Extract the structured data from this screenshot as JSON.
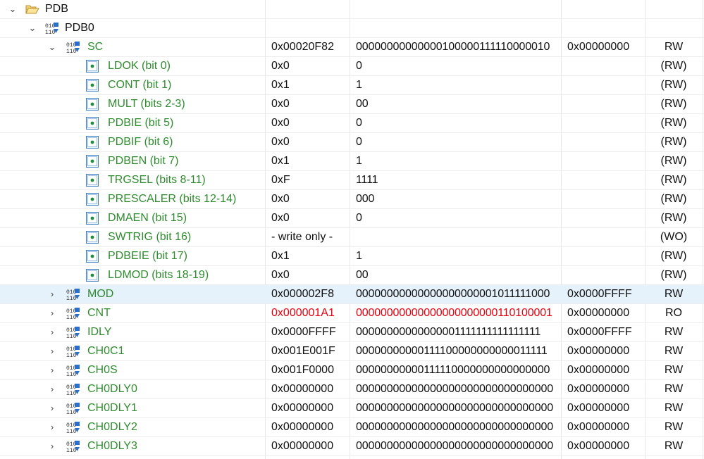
{
  "colors": {
    "field_green": "#2e8b2e",
    "changed_red": "#e8000d",
    "selected_row": "#e5f1fb"
  },
  "tree": {
    "peripheral": {
      "label": "PDB",
      "icon": "folder-open-icon"
    },
    "instance": {
      "label": "PDB0",
      "icon": "peripheral-icon"
    }
  },
  "rows": [
    {
      "kind": "register",
      "expanded": true,
      "name": "SC",
      "hex": "0x00020F82",
      "bin": "00000000000000100000111110000010",
      "reset": "0x00000000",
      "access": "RW"
    },
    {
      "kind": "field",
      "name": "LDOK (bit 0)",
      "hex": "0x0",
      "bin": "0",
      "reset": "",
      "access": "(RW)"
    },
    {
      "kind": "field",
      "name": "CONT (bit 1)",
      "hex": "0x1",
      "bin": "1",
      "reset": "",
      "access": "(RW)"
    },
    {
      "kind": "field",
      "name": "MULT (bits 2-3)",
      "hex": "0x0",
      "bin": "00",
      "reset": "",
      "access": "(RW)"
    },
    {
      "kind": "field",
      "name": "PDBIE (bit 5)",
      "hex": "0x0",
      "bin": "0",
      "reset": "",
      "access": "(RW)"
    },
    {
      "kind": "field",
      "name": "PDBIF (bit 6)",
      "hex": "0x0",
      "bin": "0",
      "reset": "",
      "access": "(RW)"
    },
    {
      "kind": "field",
      "name": "PDBEN (bit 7)",
      "hex": "0x1",
      "bin": "1",
      "reset": "",
      "access": "(RW)"
    },
    {
      "kind": "field",
      "name": "TRGSEL (bits 8-11)",
      "hex": "0xF",
      "bin": "1111",
      "reset": "",
      "access": "(RW)"
    },
    {
      "kind": "field",
      "name": "PRESCALER (bits 12-14)",
      "hex": "0x0",
      "bin": "000",
      "reset": "",
      "access": "(RW)"
    },
    {
      "kind": "field",
      "name": "DMAEN (bit 15)",
      "hex": "0x0",
      "bin": "0",
      "reset": "",
      "access": "(RW)"
    },
    {
      "kind": "field",
      "name": "SWTRIG (bit 16)",
      "hex": "- write only -",
      "bin": "",
      "reset": "",
      "access": "(WO)"
    },
    {
      "kind": "field",
      "name": "PDBEIE (bit 17)",
      "hex": "0x1",
      "bin": "1",
      "reset": "",
      "access": "(RW)"
    },
    {
      "kind": "field",
      "name": "LDMOD (bits 18-19)",
      "hex": "0x0",
      "bin": "00",
      "reset": "",
      "access": "(RW)"
    },
    {
      "kind": "register",
      "expanded": false,
      "selected": true,
      "name": "MOD",
      "hex": "0x000002F8",
      "bin": "00000000000000000000001011111000",
      "reset": "0x0000FFFF",
      "access": "RW"
    },
    {
      "kind": "register",
      "expanded": false,
      "changed": true,
      "name": "CNT",
      "hex": "0x000001A1",
      "bin": "00000000000000000000000110100001",
      "reset": "0x00000000",
      "access": "RO"
    },
    {
      "kind": "register",
      "expanded": false,
      "name": "IDLY",
      "hex": "0x0000FFFF",
      "bin": "00000000000000001111111111111111",
      "reset": "0x0000FFFF",
      "access": "RW"
    },
    {
      "kind": "register",
      "expanded": false,
      "name": "CH0C1",
      "hex": "0x001E001F",
      "bin": "00000000000111100000000000011111",
      "reset": "0x00000000",
      "access": "RW"
    },
    {
      "kind": "register",
      "expanded": false,
      "name": "CH0S",
      "hex": "0x001F0000",
      "bin": "00000000000111110000000000000000",
      "reset": "0x00000000",
      "access": "RW"
    },
    {
      "kind": "register",
      "expanded": false,
      "name": "CH0DLY0",
      "hex": "0x00000000",
      "bin": "00000000000000000000000000000000",
      "reset": "0x00000000",
      "access": "RW"
    },
    {
      "kind": "register",
      "expanded": false,
      "name": "CH0DLY1",
      "hex": "0x00000000",
      "bin": "00000000000000000000000000000000",
      "reset": "0x00000000",
      "access": "RW"
    },
    {
      "kind": "register",
      "expanded": false,
      "name": "CH0DLY2",
      "hex": "0x00000000",
      "bin": "00000000000000000000000000000000",
      "reset": "0x00000000",
      "access": "RW"
    },
    {
      "kind": "register",
      "expanded": false,
      "name": "CH0DLY3",
      "hex": "0x00000000",
      "bin": "00000000000000000000000000000000",
      "reset": "0x00000000",
      "access": "RW"
    }
  ]
}
